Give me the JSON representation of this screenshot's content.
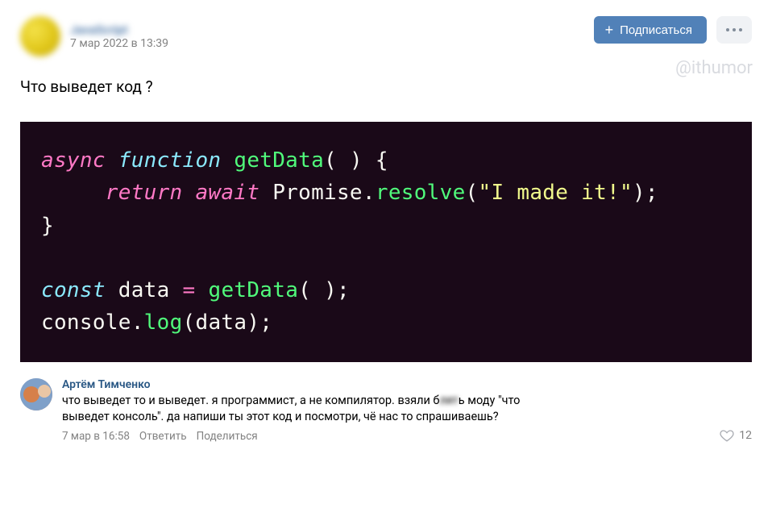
{
  "header": {
    "author_name": "JavaScript",
    "date": "7 мар 2022 в 13:39",
    "subscribe_label": "Подписаться",
    "watermark": "@ithumor"
  },
  "post": {
    "text": "Что выведет код ?"
  },
  "code": {
    "tokens": [
      [
        {
          "c": "tok-kw",
          "t": "async"
        },
        {
          "c": "tok-plain",
          "t": " "
        },
        {
          "c": "tok-decl",
          "t": "function"
        },
        {
          "c": "tok-plain",
          "t": " "
        },
        {
          "c": "tok-fn",
          "t": "getData"
        },
        {
          "c": "tok-plain",
          "t": "( )"
        },
        {
          "c": "tok-plain",
          "t": " {"
        }
      ],
      [
        {
          "c": "tok-plain",
          "t": "     "
        },
        {
          "c": "tok-kw",
          "t": "return await"
        },
        {
          "c": "tok-plain",
          "t": " "
        },
        {
          "c": "tok-ident",
          "t": "Promise"
        },
        {
          "c": "tok-plain",
          "t": "."
        },
        {
          "c": "tok-fn",
          "t": "resolve"
        },
        {
          "c": "tok-plain",
          "t": "("
        },
        {
          "c": "tok-str",
          "t": "\"I made it!\""
        },
        {
          "c": "tok-plain",
          "t": ");"
        }
      ],
      [
        {
          "c": "tok-plain",
          "t": "}"
        }
      ],
      [],
      [
        {
          "c": "tok-decl",
          "t": "const"
        },
        {
          "c": "tok-plain",
          "t": " "
        },
        {
          "c": "tok-ident",
          "t": "data"
        },
        {
          "c": "tok-plain",
          "t": " "
        },
        {
          "c": "tok-kw",
          "t": "="
        },
        {
          "c": "tok-plain",
          "t": " "
        },
        {
          "c": "tok-fn",
          "t": "getData"
        },
        {
          "c": "tok-plain",
          "t": "( );"
        }
      ],
      [
        {
          "c": "tok-ident",
          "t": "console"
        },
        {
          "c": "tok-plain",
          "t": "."
        },
        {
          "c": "tok-fn",
          "t": "log"
        },
        {
          "c": "tok-plain",
          "t": "("
        },
        {
          "c": "tok-ident",
          "t": "data"
        },
        {
          "c": "tok-plain",
          "t": ");"
        }
      ]
    ]
  },
  "comment": {
    "author": "Артём Тимченко",
    "text_parts": [
      "что выведет то и выведет. я программист, а не компилятор. взяли б",
      "лят",
      "ь моду \"что\nвыведет консоль\". да напиши ты этот код и посмотри, чё нас то спрашиваешь?"
    ],
    "date": "7 мар в 16:58",
    "reply_label": "Ответить",
    "share_label": "Поделиться",
    "likes": "12"
  }
}
